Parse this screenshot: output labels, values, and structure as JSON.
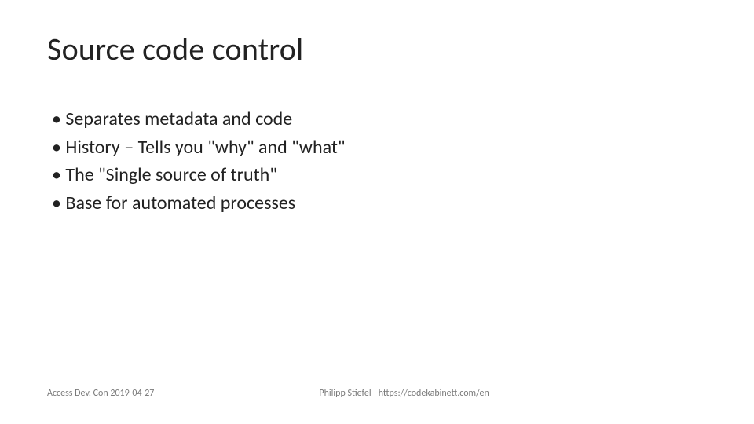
{
  "slide": {
    "title": "Source code control",
    "bullets": [
      "Separates metadata and code",
      "History – Tells you \"why\" and \"what\"",
      "The \"Single source of truth\"",
      "Base for automated processes"
    ],
    "footer_left": "Access Dev. Con 2019-04-27",
    "footer_right": "Philipp Stiefel - https://codekabinett.com/en"
  }
}
